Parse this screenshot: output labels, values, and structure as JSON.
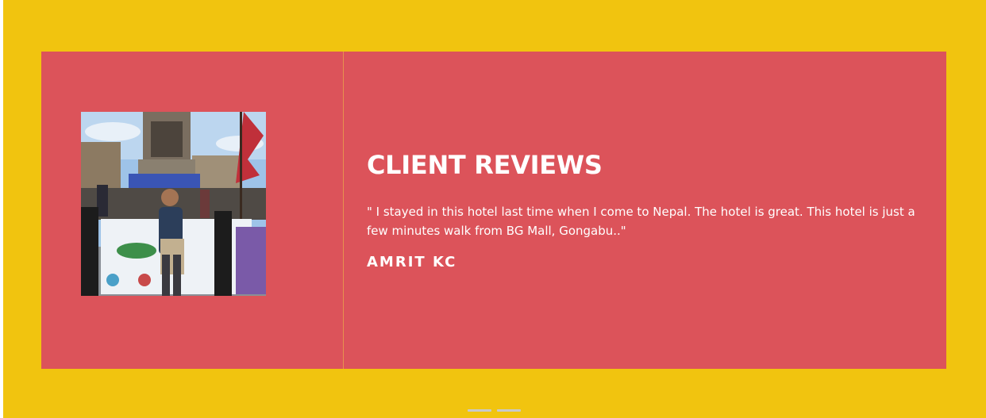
{
  "testimonial": {
    "heading": "CLIENT REVIEWS",
    "quote": "\" I stayed in this hotel last time when I come to Nepal. The hotel is great. This hotel is just a few minutes walk from BG Mall, Gongabu..\"",
    "author": "AMRIT KC",
    "photo_icon": "client-photo"
  },
  "carousel": {
    "slides": 2
  },
  "colors": {
    "background": "#f1c40f",
    "card": "#dc535a",
    "divider": "#e6914e",
    "text": "#ffffff",
    "dot": "#c9c9c9"
  }
}
